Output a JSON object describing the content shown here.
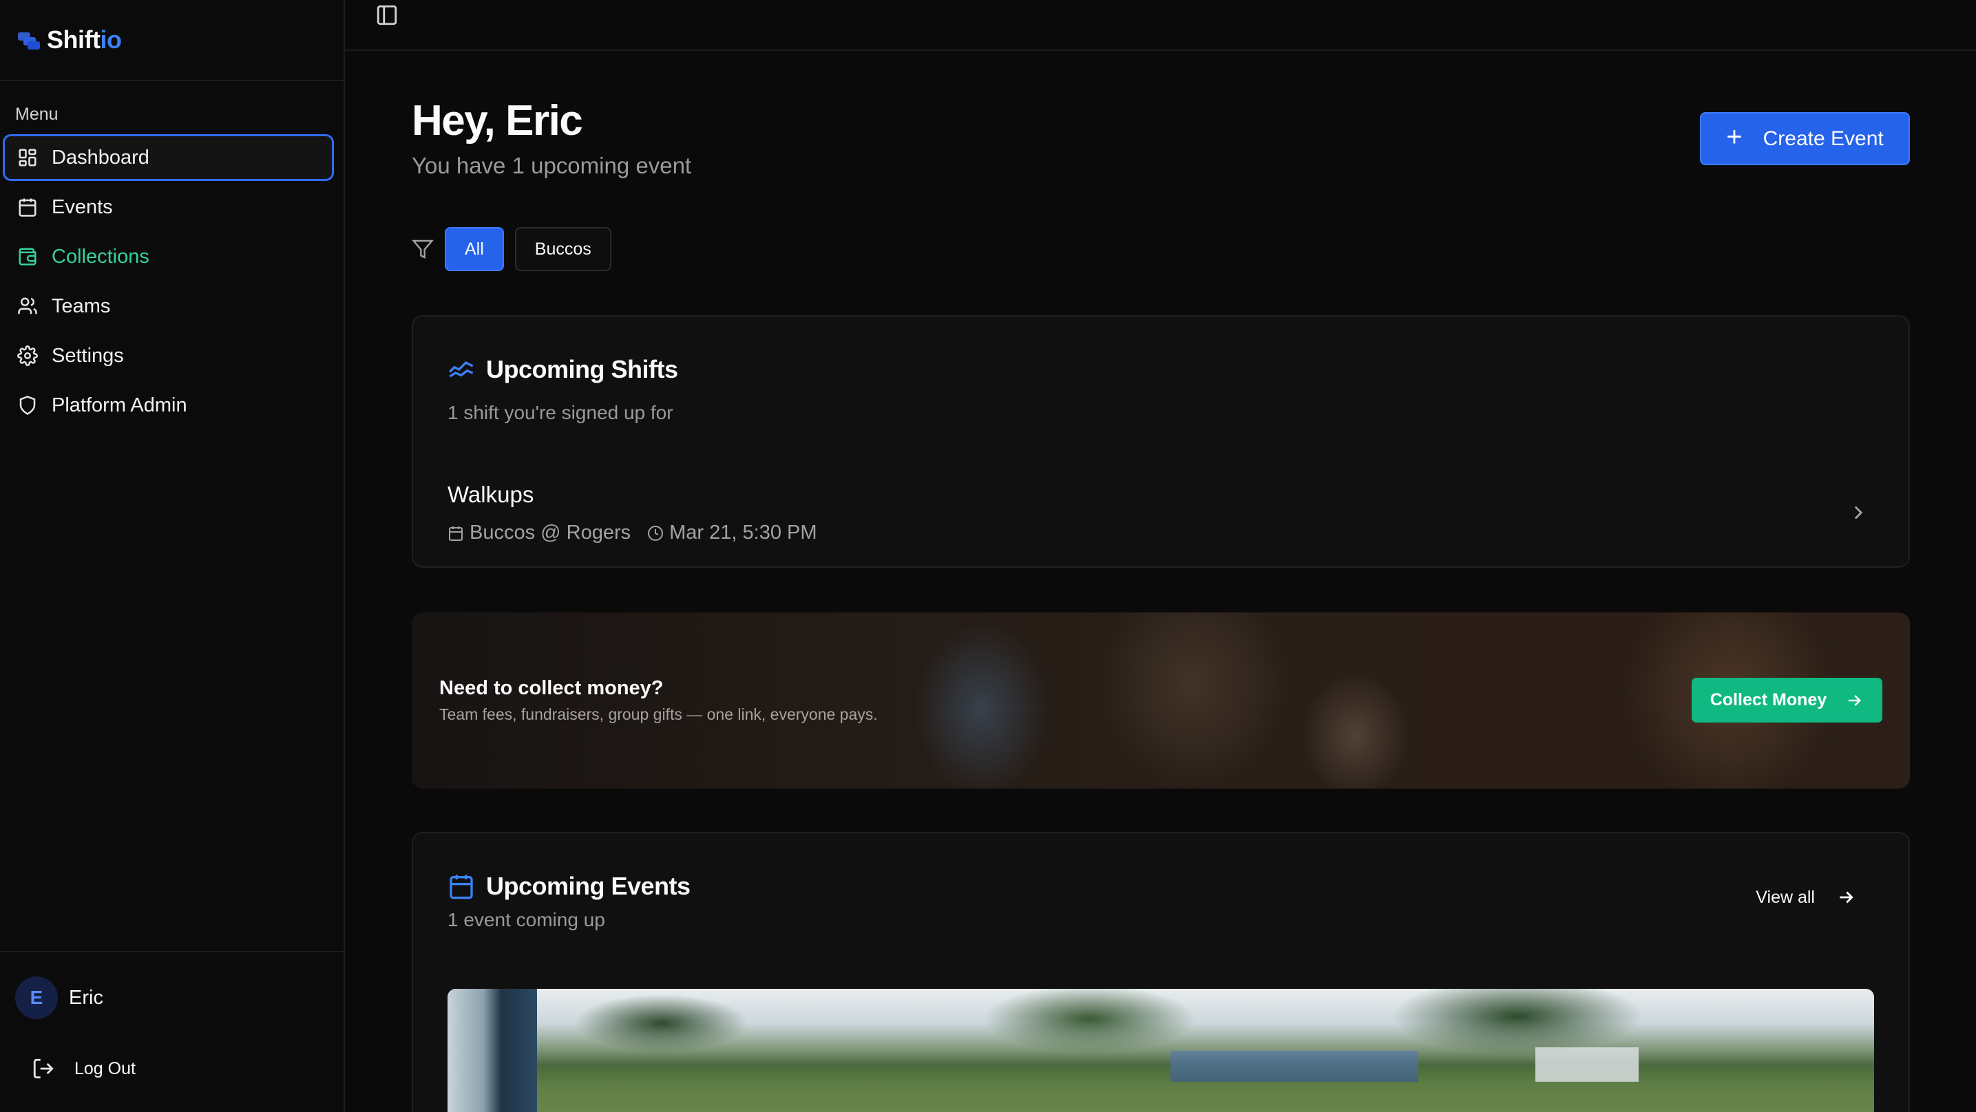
{
  "brand": {
    "name_main": "Shift",
    "name_accent": "io"
  },
  "sidebar": {
    "menu_label": "Menu",
    "items": [
      {
        "label": "Dashboard",
        "icon": "dashboard-icon"
      },
      {
        "label": "Events",
        "icon": "calendar-icon"
      },
      {
        "label": "Collections",
        "icon": "wallet-icon"
      },
      {
        "label": "Teams",
        "icon": "users-icon"
      },
      {
        "label": "Settings",
        "icon": "gear-icon"
      },
      {
        "label": "Platform Admin",
        "icon": "shield-icon"
      }
    ],
    "user": {
      "initial": "E",
      "name": "Eric"
    },
    "logout_label": "Log Out"
  },
  "header": {
    "greeting": "Hey, Eric",
    "subtitle": "You have 1 upcoming event",
    "create_label": "Create Event"
  },
  "filters": {
    "options": [
      "All",
      "Buccos"
    ],
    "selected": "All"
  },
  "shifts": {
    "title": "Upcoming Shifts",
    "subtitle": "1 shift you're signed up for",
    "items": [
      {
        "name": "Walkups",
        "event": "Buccos @ Rogers",
        "time": "Mar 21, 5:30 PM"
      }
    ]
  },
  "promo": {
    "title": "Need to collect money?",
    "subtitle": "Team fees, fundraisers, group gifts — one link, everyone pays.",
    "button_label": "Collect Money"
  },
  "events": {
    "title": "Upcoming Events",
    "subtitle": "1 event coming up",
    "view_all_label": "View all"
  },
  "colors": {
    "accent_blue": "#2563eb",
    "accent_green": "#10b981",
    "active_border": "#2d6df0"
  }
}
